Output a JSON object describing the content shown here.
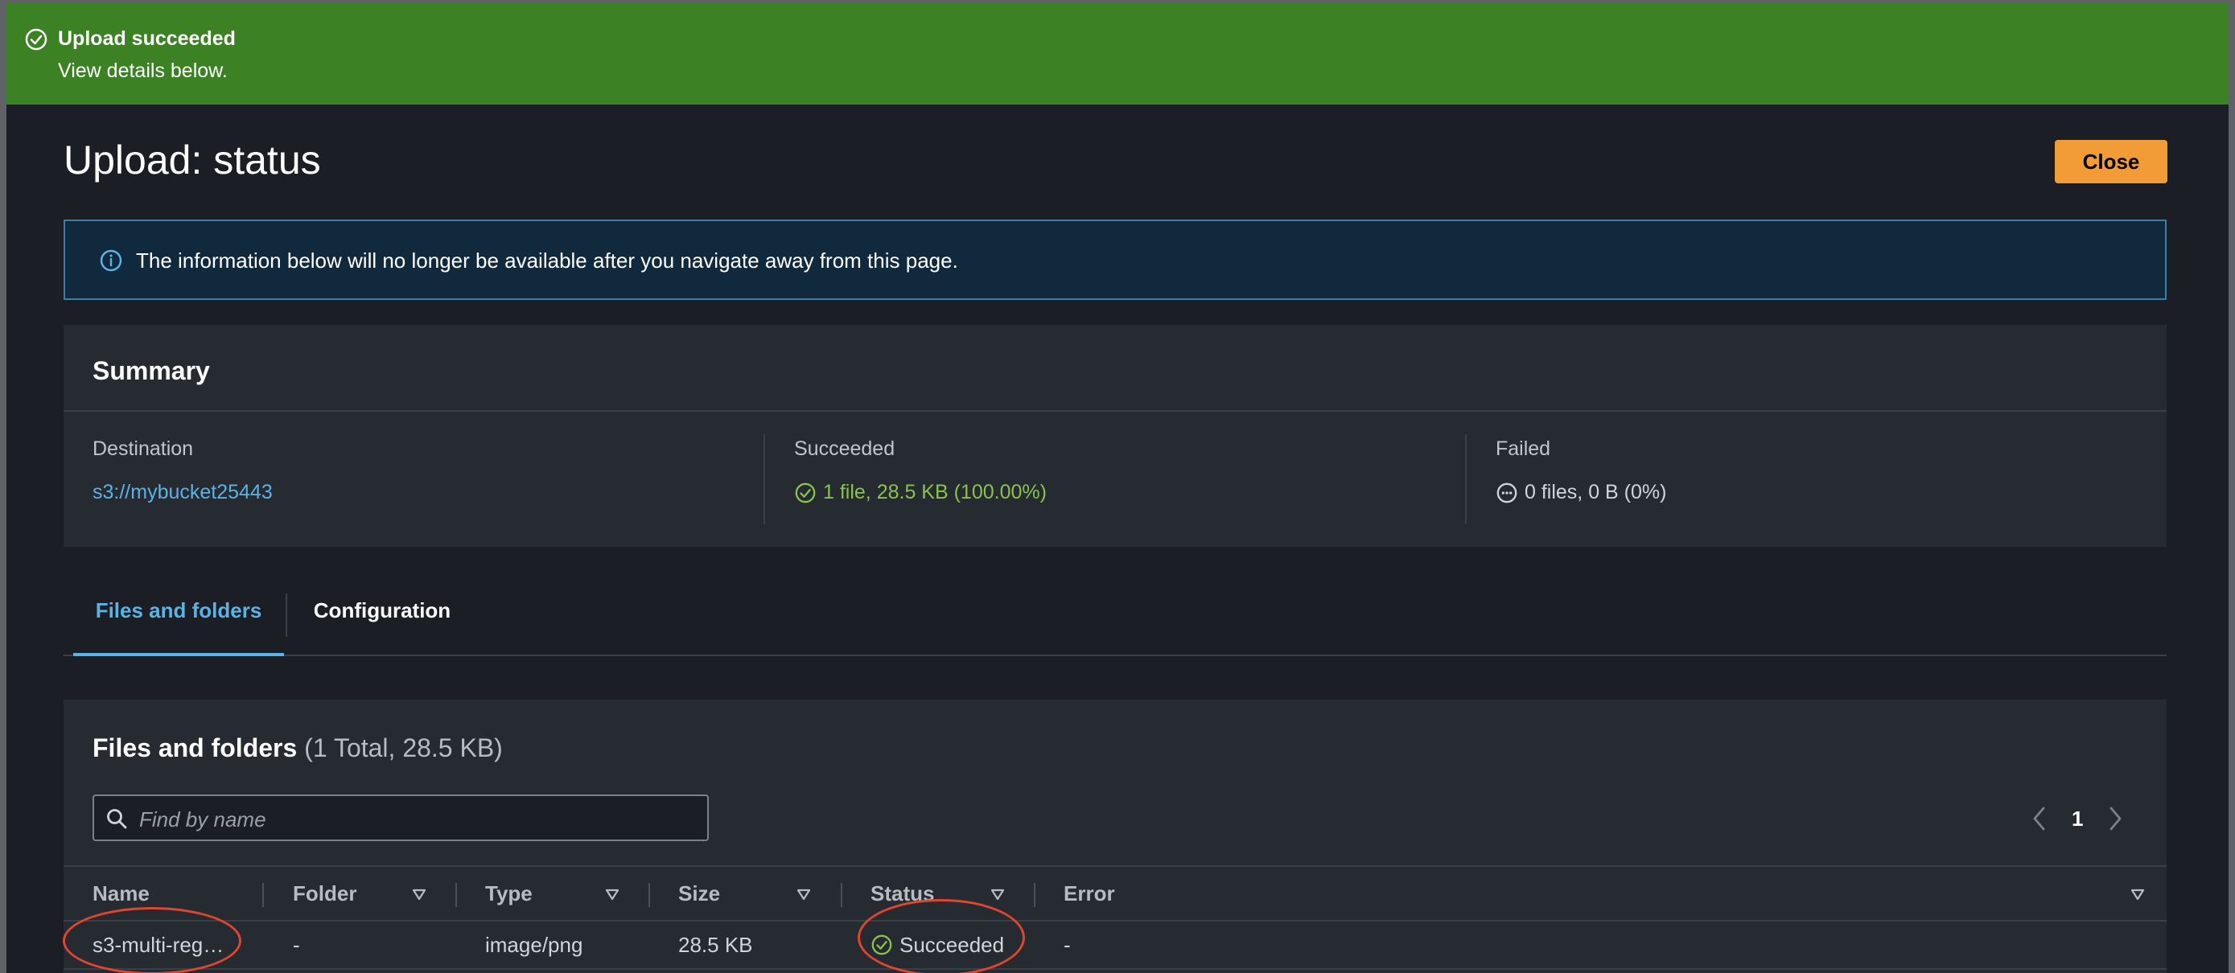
{
  "flash": {
    "title": "Upload succeeded",
    "message": "View details below.",
    "icon": "check-circle-icon",
    "color": "#3c8224"
  },
  "header": {
    "title": "Upload: status",
    "close_label": "Close"
  },
  "info": {
    "icon": "info-circle-icon",
    "text": "The information below will no longer be available after you navigate away from this page."
  },
  "summary": {
    "title": "Summary",
    "destination": {
      "label": "Destination",
      "value": "s3://mybucket25443"
    },
    "succeeded": {
      "label": "Succeeded",
      "value": "1 file, 28.5 KB (100.00%)"
    },
    "failed": {
      "label": "Failed",
      "value": "0 files, 0 B (0%)"
    }
  },
  "tabs": [
    {
      "label": "Files and folders",
      "active": true
    },
    {
      "label": "Configuration",
      "active": false
    }
  ],
  "files": {
    "title": "Files and folders",
    "count": "(1 Total, 28.5 KB)",
    "search_placeholder": "Find by name",
    "page": "1",
    "columns": [
      "Name",
      "Folder",
      "Type",
      "Size",
      "Status",
      "Error"
    ],
    "rows": [
      {
        "name": "s3-multi-reg…",
        "folder": "-",
        "type": "image/png",
        "size": "28.5 KB",
        "status": "Succeeded",
        "error": "-"
      }
    ]
  },
  "colors": {
    "accent_link": "#5bb2e6",
    "success": "#89c24f",
    "primary_button": "#f29c38",
    "annotation": "#e0452f"
  }
}
